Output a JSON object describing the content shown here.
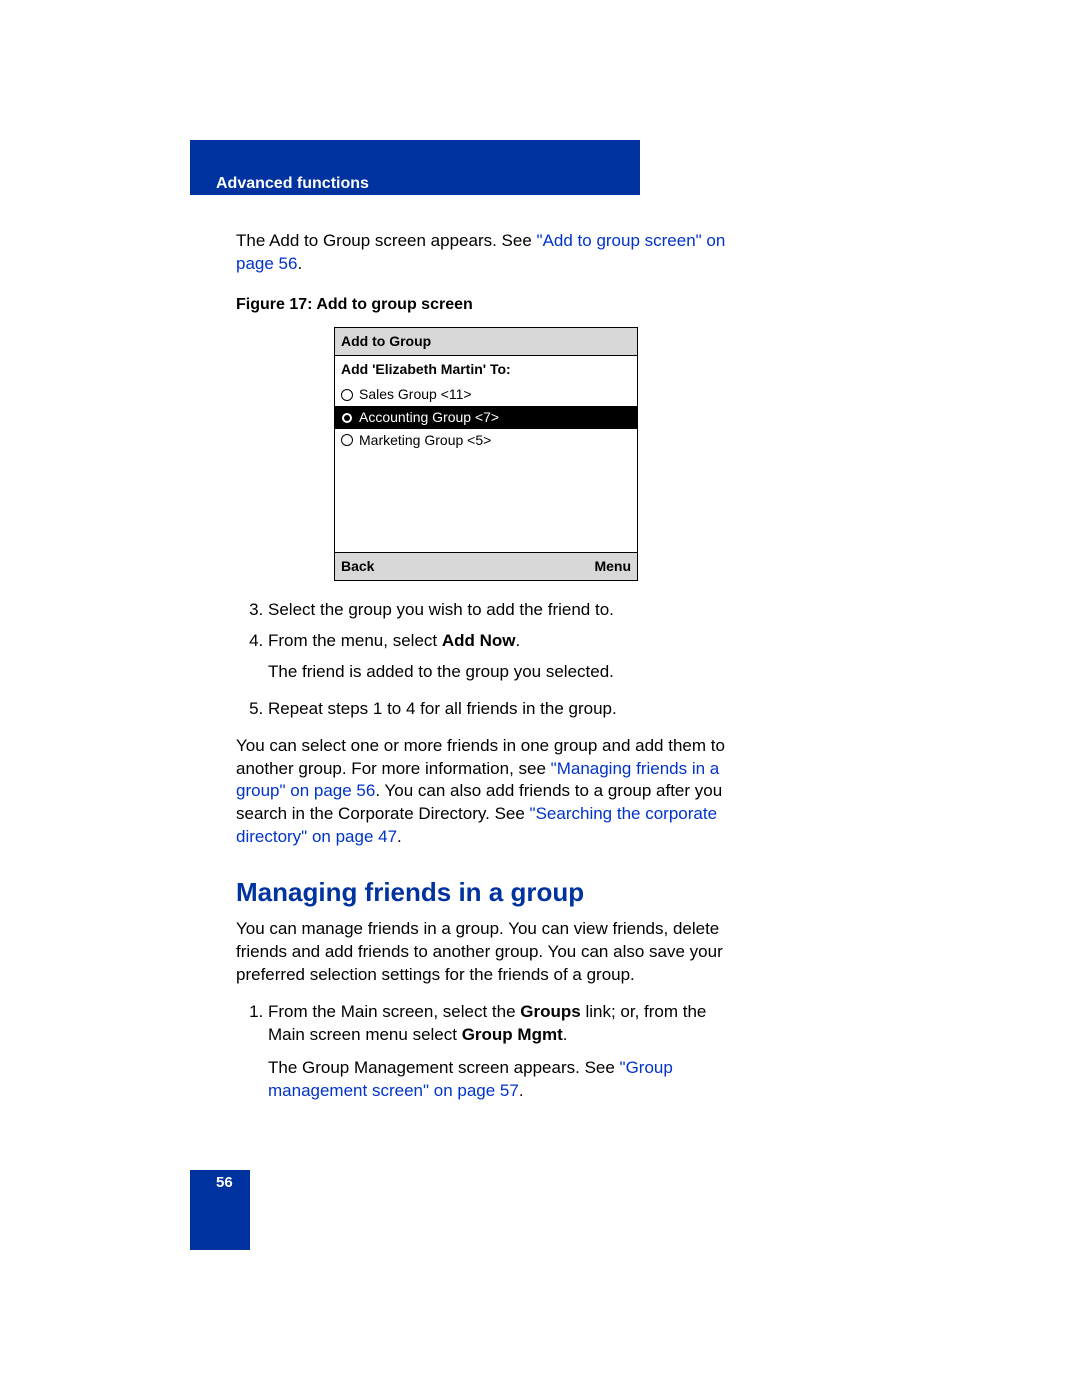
{
  "header": {
    "section": "Advanced functions"
  },
  "intro": {
    "text_before": "The Add to Group screen appears. See ",
    "link": "\"Add to group screen\" on page 56",
    "text_after": "."
  },
  "figure": {
    "caption": "Figure 17: Add to group screen",
    "screen": {
      "title": "Add to Group",
      "subtitle": "Add 'Elizabeth Martin' To:",
      "options": [
        {
          "label": "Sales Group <11>",
          "selected": false
        },
        {
          "label": "Accounting Group <7>",
          "selected": true
        },
        {
          "label": "Marketing Group <5>",
          "selected": false
        }
      ],
      "footer_left": "Back",
      "footer_right": "Menu"
    }
  },
  "steps_a": {
    "start": 3,
    "items": [
      {
        "text": "Select the group you wish to add the friend to."
      },
      {
        "pre": "From the menu, select ",
        "bold": "Add Now",
        "post": ".",
        "note": "The friend is added to the group you selected."
      },
      {
        "text": "Repeat steps 1 to 4 for all friends in the group."
      }
    ]
  },
  "para2": {
    "t1": "You can select one or more friends in one group and add them to another group. For more information, see ",
    "link1": "\"Managing friends in a group\" on page 56",
    "t2": ". You can also add friends to a group after you search in the Corporate Directory. See ",
    "link2": "\"Searching the corporate directory\" on page 47",
    "t3": "."
  },
  "section2": {
    "heading": "Managing friends in a group",
    "intro": "You can manage friends in a group. You can view friends, delete friends and add friends to another group. You can also save your preferred selection settings for the friends of a group."
  },
  "steps_b": {
    "start": 1,
    "item1": {
      "pre": "From the Main screen, select the ",
      "b1": "Groups",
      "mid": " link; or, from the Main screen menu select ",
      "b2": "Group Mgmt",
      "post": "."
    },
    "note": {
      "pre": "The Group Management screen appears. See ",
      "link": "\"Group management screen\" on page 57",
      "post": "."
    }
  },
  "page_number": "56"
}
